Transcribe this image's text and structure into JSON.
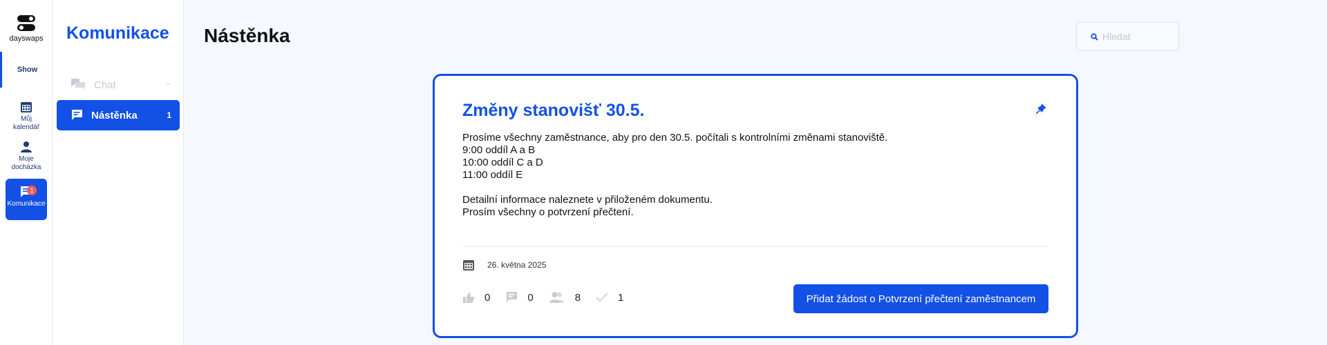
{
  "brand": {
    "name": "dayswaps"
  },
  "rail": {
    "show_label": "Show",
    "items": [
      {
        "label_line1": "Můj",
        "label_line2": "kalendář",
        "icon": "calendar-icon"
      },
      {
        "label_line1": "Moje",
        "label_line2": "docházka",
        "icon": "person-icon"
      },
      {
        "label_line1": "Komunikace",
        "icon": "chat-icon",
        "badge": "1",
        "active": true
      }
    ]
  },
  "sidebar": {
    "title": "Komunikace",
    "items": [
      {
        "label": "Chat",
        "icon": "chat-bubbles-icon",
        "chevron": "⌄",
        "enabled": false
      },
      {
        "label": "Nástěnka",
        "icon": "board-message-icon",
        "count": "1",
        "active": true
      }
    ]
  },
  "header": {
    "title": "Nástěnka",
    "search_placeholder": "Hledat"
  },
  "post": {
    "title": "Změny stanovišť 30.5.",
    "pinned": true,
    "body_lines_1": [
      "Prosíme všechny zaměstnance, aby pro den 30.5. počítali s kontrolními změnami stanoviště.",
      "9:00 oddíl A a B",
      "10:00 oddíl C a D",
      "11:00 oddíl E"
    ],
    "body_lines_2": [
      "Detailní informace naleznete v přiloženém dokumentu.",
      "Prosím všechny o potvrzení přečtení."
    ],
    "date": "26. května 2025",
    "stats": {
      "likes": "0",
      "comments": "0",
      "recipients": "8",
      "confirmed": "1"
    },
    "confirm_button_label": "Přidat žádost o Potvrzení přečtení zaměstnancem"
  },
  "colors": {
    "accent": "#1250e6",
    "badge": "#f15c5c",
    "background": "#f5f8fe"
  }
}
